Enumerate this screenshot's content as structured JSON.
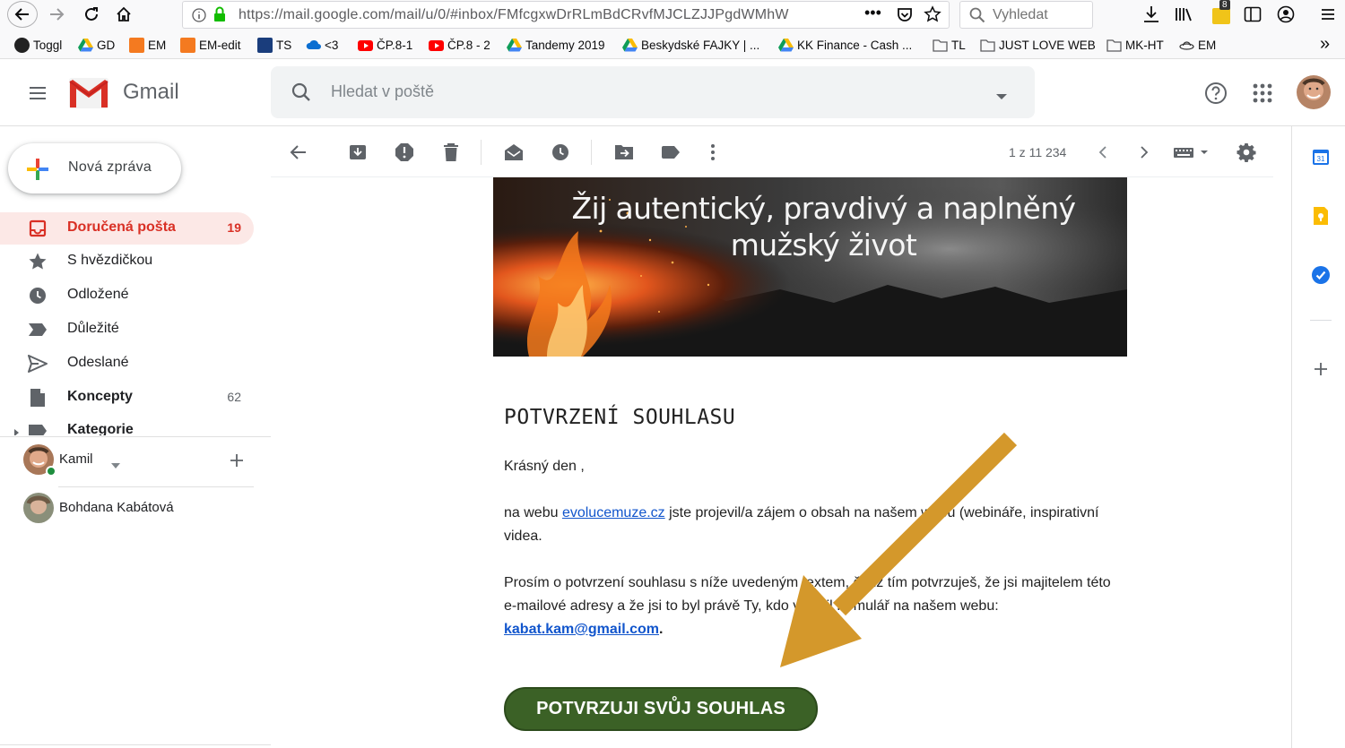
{
  "browser": {
    "url": "https://mail.google.com/mail/u/0/#inbox/FMfcgxwDrRLmBdCRvfMJCLZJJPgdWMhW",
    "search_placeholder": "Vyhledat",
    "extension_badge": "8",
    "bookmarks": [
      {
        "label": "Toggl",
        "icon": "toggl-icon"
      },
      {
        "label": "GD",
        "icon": "google-drive-icon"
      },
      {
        "label": "EM",
        "icon": "orange-app-icon"
      },
      {
        "label": "EM-edit",
        "icon": "orange-app-icon"
      },
      {
        "label": "TS",
        "icon": "chart-icon"
      },
      {
        "label": "<3",
        "icon": "cloud-icon"
      },
      {
        "label": "ČP.8-1",
        "icon": "youtube-icon"
      },
      {
        "label": "ČP.8 - 2",
        "icon": "youtube-icon"
      },
      {
        "label": "Tandemy 2019",
        "icon": "google-drive-icon"
      },
      {
        "label": "Beskydské FAJKY | ...",
        "icon": "google-drive-icon"
      },
      {
        "label": "KK Finance - Cash ...",
        "icon": "google-drive-icon"
      },
      {
        "label": "TL",
        "icon": "folder-icon"
      },
      {
        "label": "JUST LOVE WEB",
        "icon": "folder-icon"
      },
      {
        "label": "MK-HT",
        "icon": "folder-icon"
      },
      {
        "label": "EM",
        "icon": "ufo-icon"
      }
    ]
  },
  "gmail": {
    "wordmark": "Gmail",
    "search_placeholder": "Hledat v poště",
    "compose_label": "Nová zpráva",
    "nav": [
      {
        "label": "Doručená pošta",
        "count": "19",
        "icon": "inbox-icon",
        "active": true
      },
      {
        "label": "S hvězdičkou",
        "count": "",
        "icon": "star-icon"
      },
      {
        "label": "Odložené",
        "count": "",
        "icon": "clock-icon"
      },
      {
        "label": "Důležité",
        "count": "",
        "icon": "important-icon"
      },
      {
        "label": "Odeslané",
        "count": "",
        "icon": "send-icon"
      },
      {
        "label": "Koncepty",
        "count": "62",
        "icon": "draft-icon",
        "bold": true
      },
      {
        "label": "Kategorie",
        "count": "",
        "icon": "label-icon",
        "bold": true
      }
    ],
    "hangouts": {
      "me": "Kamil",
      "contacts": [
        "Bohdana Kabátová"
      ]
    },
    "pager": "1 z 11 234",
    "side_panel": [
      "calendar-icon",
      "keep-icon",
      "tasks-icon",
      "add-icon"
    ],
    "calendar_day": "31"
  },
  "email": {
    "banner_line1": "Žij autentický, pravdivý a naplněný",
    "banner_line2": "mužský život",
    "heading": "POTVRZENÍ SOUHLASU",
    "greeting": "Krásný den ,",
    "p1_before": "na webu ",
    "p1_link": "evolucemuze.cz",
    "p1_after": " jste projevil/a zájem o obsah na našem webu (webináře, inspirativní videa.",
    "p2_text": "Prosím o potvrzení souhlasu s níže uvedeným textem, čímž tím potvrzuješ, že jsi majitelem této e-mailové adresy a že jsi to byl právě Ty, kdo vyplnil formulář na našem webu: ",
    "p2_email": "kabat.kam@gmail.com",
    "p2_end": ".",
    "button_label": "POTVRZUJI SVŮJ SOUHLAS"
  },
  "colors": {
    "accent_red": "#d93025",
    "active_nav_bg": "#fce8e6",
    "button_green": "#3b6126",
    "arrow": "#d4982b",
    "link": "#1155cc"
  }
}
